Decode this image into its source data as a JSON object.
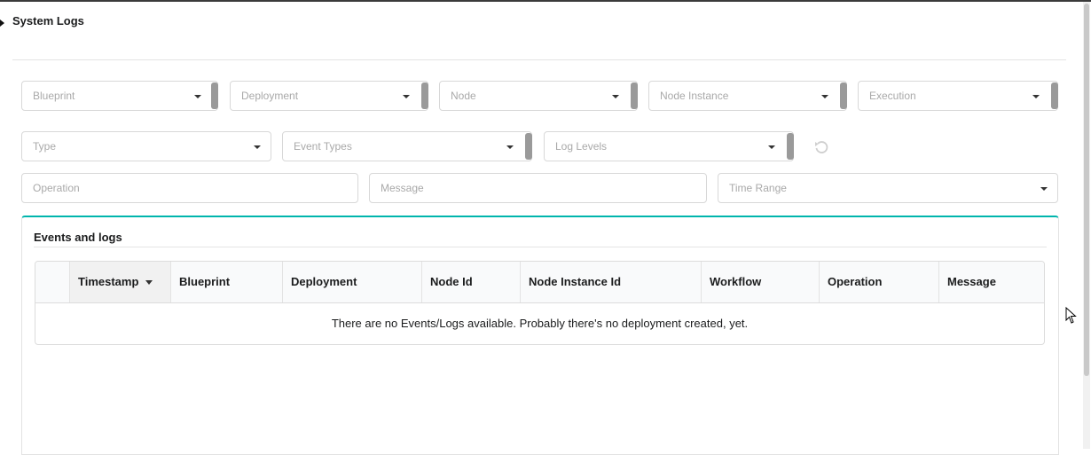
{
  "page": {
    "title": "System Logs"
  },
  "filters": {
    "row1": [
      {
        "name": "blueprint",
        "placeholder": "Blueprint"
      },
      {
        "name": "deployment",
        "placeholder": "Deployment"
      },
      {
        "name": "node",
        "placeholder": "Node"
      },
      {
        "name": "node-instance",
        "placeholder": "Node Instance"
      },
      {
        "name": "execution",
        "placeholder": "Execution"
      }
    ],
    "row2": [
      {
        "name": "type",
        "placeholder": "Type"
      },
      {
        "name": "event-types",
        "placeholder": "Event Types"
      },
      {
        "name": "log-levels",
        "placeholder": "Log Levels"
      }
    ],
    "operation_placeholder": "Operation",
    "message_placeholder": "Message",
    "time_range_placeholder": "Time Range",
    "reset_icon": "reset-icon"
  },
  "events": {
    "title": "Events and logs",
    "columns": [
      "Timestamp",
      "Blueprint",
      "Deployment",
      "Node Id",
      "Node Instance Id",
      "Workflow",
      "Operation",
      "Message"
    ],
    "sorted_column": "Timestamp",
    "empty_message": "There are no Events/Logs available. Probably there's no deployment created, yet."
  },
  "colors": {
    "accent": "#00b5ad"
  }
}
